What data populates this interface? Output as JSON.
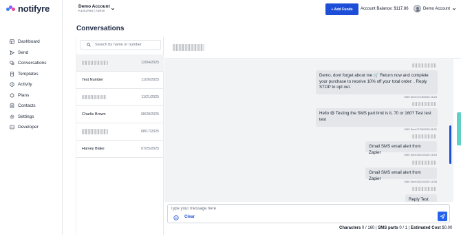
{
  "brand": {
    "name": "notifyre"
  },
  "nav": [
    {
      "label": "Dashboard",
      "icon": "dashboard-icon"
    },
    {
      "label": "Send",
      "icon": "send-icon"
    },
    {
      "label": "Conversations",
      "icon": "chat-icon"
    },
    {
      "label": "Templates",
      "icon": "template-icon"
    },
    {
      "label": "Activity",
      "icon": "activity-icon"
    },
    {
      "label": "Plans",
      "icon": "plans-icon"
    },
    {
      "label": "Contacts",
      "icon": "contacts-icon"
    },
    {
      "label": "Settings",
      "icon": "gear-icon"
    },
    {
      "label": "Developer",
      "icon": "code-icon"
    }
  ],
  "account": {
    "name": "Demo Account",
    "sub": "K1SUA84 | Admin"
  },
  "header": {
    "add_funds": "+ Add Funds",
    "balance": "Account Balance: $117.86",
    "user": "Demo Account"
  },
  "page": {
    "title": "Conversations"
  },
  "search": {
    "placeholder": "Search by name or number"
  },
  "conversations": [
    {
      "name": "",
      "date": "12/04/2025",
      "selected": true
    },
    {
      "name": "Test Number",
      "date": "11/26/2025"
    },
    {
      "name": "",
      "date": "11/21/2025"
    },
    {
      "name": "Charlie Brown",
      "date": "08/28/2025"
    },
    {
      "name": "",
      "date": "08/17/2025"
    },
    {
      "name": "Harvey Blake",
      "date": "07/25/2025"
    }
  ],
  "messages": [
    {
      "text": "Demo, dont forget about me 🛒 Return now and complete your purchase to receive 10% off your total order: . Reply STOP to opt out.",
      "meta": "SMS Sent 07/18/2025 16:23"
    },
    {
      "text": "Hello 😃 Testing the SMS part limit is it, 70 or 160? Test test test",
      "meta": "SMS Sent 07/28/2025 08:31"
    },
    {
      "text": "Gmail SMS email alert from Zapier",
      "meta": "SMS Sent 08/21/2025 16:15"
    },
    {
      "text": "Gmail SMS email alert from Zapier",
      "meta": "SMS Sent 08/21/2025 16:36"
    },
    {
      "text": "Reply Test",
      "meta": ""
    }
  ],
  "composer": {
    "placeholder": "Type your message here",
    "clear": "Clear",
    "characters_label": "Characters",
    "characters_value": "0 / 160",
    "sms_parts_label": "SMS parts",
    "sms_parts_value": "0 / 1",
    "cost_label": "Estimated Cost",
    "cost_value": "$0.00"
  },
  "colors": {
    "primary": "#1d4ed8",
    "brand_pink": "#ec4899",
    "brand_blue": "#3b82f6",
    "brand_purple": "#8b5cf6",
    "chat_bg": "#f2f3f5",
    "bubble": "#e4e6ea"
  }
}
